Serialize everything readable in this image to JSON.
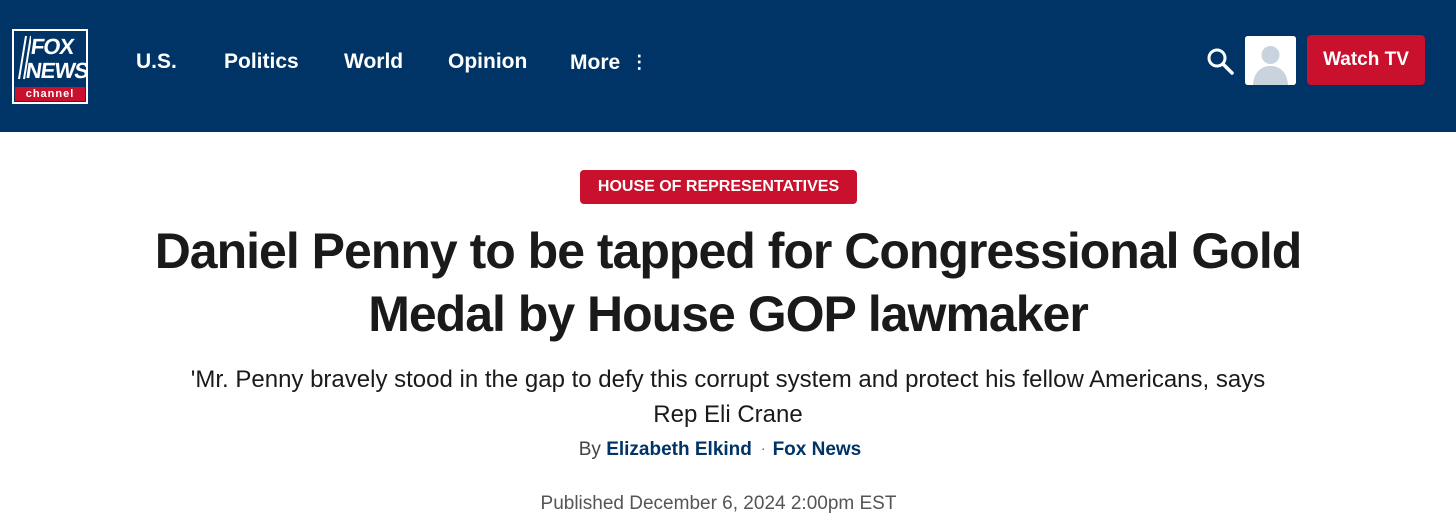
{
  "header": {
    "logo": {
      "line1": "FOX",
      "line2": "NEWS",
      "line3": "channel"
    },
    "nav": [
      {
        "label": "U.S."
      },
      {
        "label": "Politics"
      },
      {
        "label": "World"
      },
      {
        "label": "Opinion"
      },
      {
        "label": "More",
        "icon": "vertical-ellipsis-icon"
      }
    ],
    "search_icon": "search-icon",
    "avatar_icon": "user-avatar-icon",
    "watch_label": "Watch TV"
  },
  "article": {
    "category": "HOUSE OF REPRESENTATIVES",
    "headline_line1": "Daniel Penny to be tapped for Congressional Gold",
    "headline_line2": "Medal by House GOP lawmaker",
    "subhead_line1": "'Mr. Penny bravely stood in the gap to defy this corrupt system and protect his fellow Americans, says",
    "subhead_line2": "Rep Eli Crane",
    "byline": {
      "prefix": "By",
      "author": "Elizabeth Elkind",
      "separator": "·",
      "outlet": "Fox News"
    },
    "published": "Published December 6, 2024 2:00pm EST"
  },
  "colors": {
    "brand_navy": "#003366",
    "accent_red": "#c9102d",
    "text_dark": "#1a1a1a",
    "link_navy": "#003366"
  }
}
